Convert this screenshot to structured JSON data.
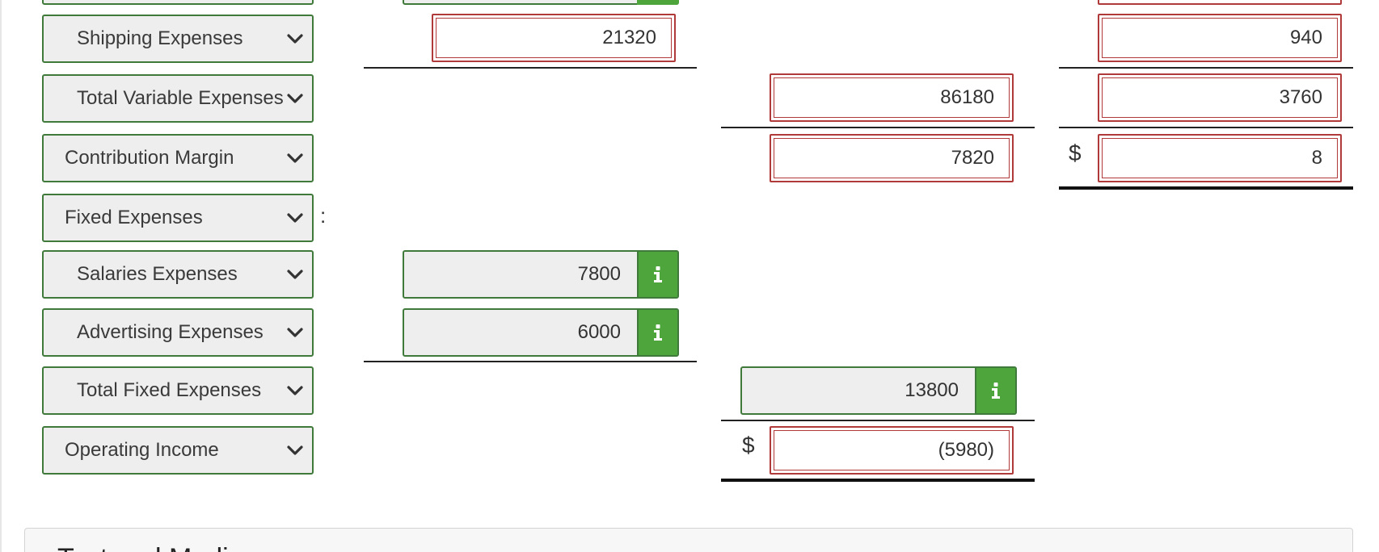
{
  "rows": {
    "shipping": {
      "label": "Shipping Expenses",
      "mid": "21320",
      "right": "940"
    },
    "total_variable": {
      "label": "Total Variable Expenses",
      "total": "86180",
      "right": "3760"
    },
    "contribution_margin": {
      "label": "Contribution Margin",
      "total": "7820",
      "right": "8"
    },
    "fixed": {
      "label": "Fixed Expenses"
    },
    "salaries": {
      "label": "Salaries Expenses",
      "mid": "7800"
    },
    "advertising": {
      "label": "Advertising Expenses",
      "mid": "6000"
    },
    "total_fixed": {
      "label": "Total Fixed Expenses",
      "total": "13800"
    },
    "operating_income": {
      "label": "Operating Income",
      "total": "(5980)"
    }
  },
  "symbols": {
    "dollar": "$",
    "colon": ":"
  },
  "next_panel": {
    "title": "Text and Media"
  },
  "colors": {
    "input_border_green": "#3f7a3a",
    "error_border_red": "#b03a3a",
    "info_button_green": "#4ea53b",
    "field_bg": "#eeeeee"
  },
  "icons": {
    "dropdown": "chevron-down-icon",
    "info": "info-icon"
  }
}
